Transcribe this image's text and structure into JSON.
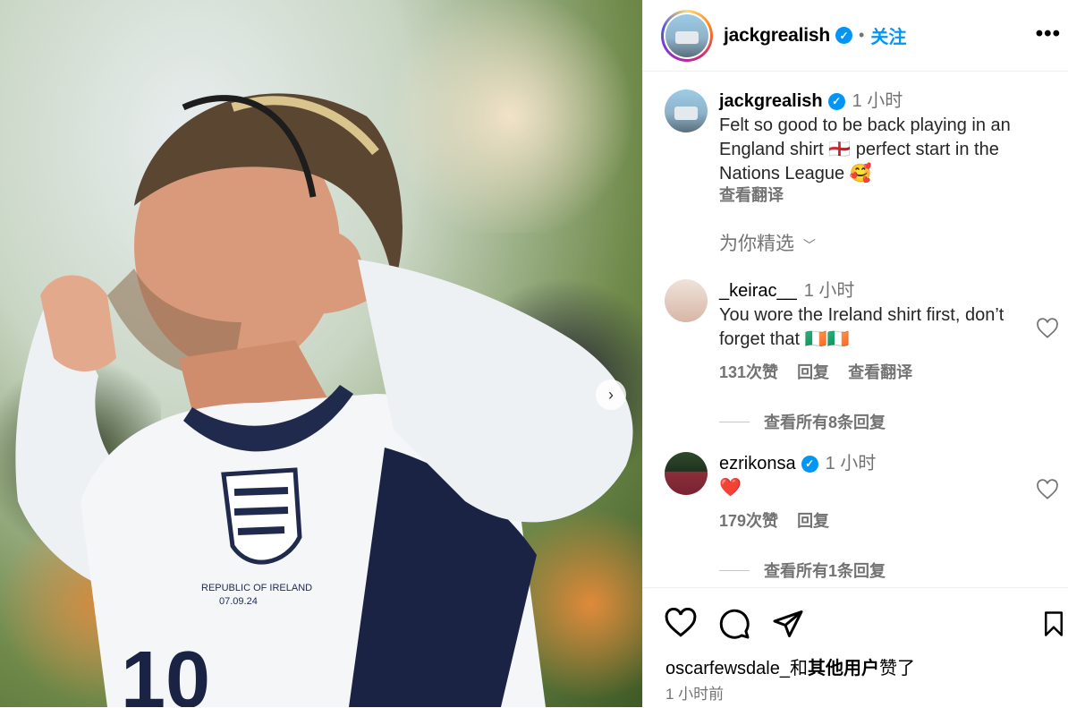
{
  "post": {
    "author": "jackgrealish",
    "follow_label": "关注",
    "more_label": "•••",
    "next_label": "›"
  },
  "caption": {
    "username": "jackgrealish",
    "time": "1 小时",
    "text": "Felt so good to be back playing in an England shirt 🏴󠁧󠁢󠁥󠁮󠁧󠁿 perfect start in the Nations League 🥰",
    "translate": "查看翻译"
  },
  "suggested_label": "为你精选",
  "comments": [
    {
      "username": "_keirac__",
      "time": "1 小时",
      "text": "You wore the Ireland shirt first, don’t forget that 🇮🇪🇮🇪",
      "likes": "131次赞",
      "reply": "回复",
      "translate": "查看翻译",
      "view_replies": "查看所有8条回复"
    },
    {
      "username": "ezrikonsa",
      "time": "1 小时",
      "text": "❤️",
      "likes": "179次赞",
      "reply": "回复",
      "view_replies": "查看所有1条回复"
    }
  ],
  "footer": {
    "liked_by_user": "oscarfewsdale_",
    "liked_by_and": "和",
    "liked_by_others": "其他用户",
    "liked_by_suffix": "赞了",
    "time_ago": "1 小时前"
  },
  "colors": {
    "accent": "#0095f6",
    "muted": "#737373",
    "heart": "#ff3040"
  }
}
